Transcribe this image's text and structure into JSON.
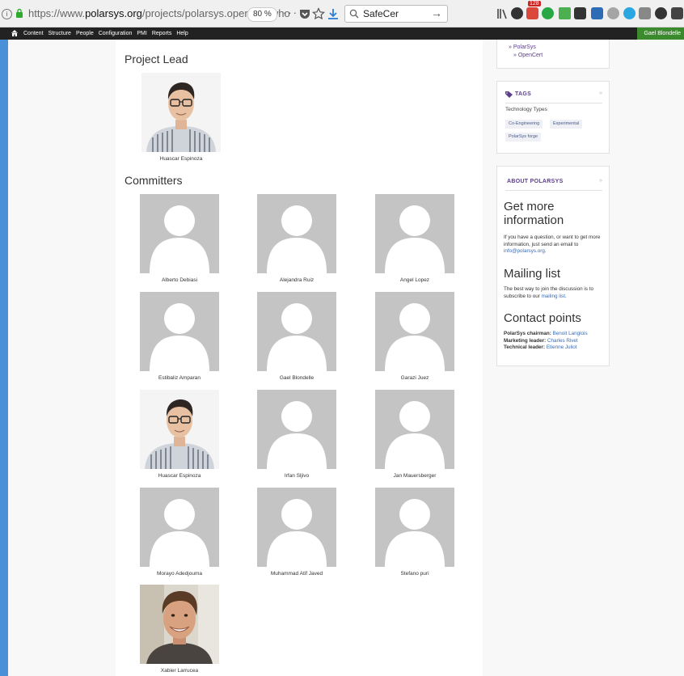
{
  "browser": {
    "url_prefix": "https://www.",
    "url_domain": "polarsys.org",
    "url_path": "/projects/polarsys.opencert/who",
    "zoom": "80 %",
    "page_actions": "···",
    "search_text": "SafeCer",
    "search_go": "→",
    "badge_128": "128",
    "info_glyph": "i"
  },
  "admin_bar": {
    "menu": [
      "Content",
      "Structure",
      "People",
      "Configuration",
      "PMI",
      "Reports",
      "Help"
    ],
    "user": "Gael Blondelle"
  },
  "project_lead": {
    "heading": "Project Lead",
    "name": "Huascar Espinoza"
  },
  "committers": {
    "heading": "Committers",
    "people": [
      {
        "name": "Alberto Debiasi",
        "photo": "placeholder"
      },
      {
        "name": "Alejandra Ruiz",
        "photo": "placeholder"
      },
      {
        "name": "Angel Lopez",
        "photo": "placeholder"
      },
      {
        "name": "Estibaliz Amparan",
        "photo": "placeholder"
      },
      {
        "name": "Gael Blondelle",
        "photo": "placeholder"
      },
      {
        "name": "Garazi Juez",
        "photo": "placeholder"
      },
      {
        "name": "Huascar Espinoza",
        "photo": "man-glasses"
      },
      {
        "name": "Irfan Sljivo",
        "photo": "placeholder"
      },
      {
        "name": "Jan Mauersberger",
        "photo": "placeholder"
      },
      {
        "name": "Morayo Adedjouma",
        "photo": "placeholder"
      },
      {
        "name": "Muhammad Atif Javed",
        "photo": "placeholder"
      },
      {
        "name": "Stefano puri",
        "photo": "placeholder"
      },
      {
        "name": "Xabier Larrucea",
        "photo": "man-smiling"
      }
    ]
  },
  "sidebar": {
    "breadcrumb": [
      "» PolarSys",
      "» OpenCert"
    ],
    "tags": {
      "title": "TAGS",
      "collapse": "»",
      "group": "Technology Types",
      "chips": [
        "Co-Engineering",
        "Experimental",
        "PolarSys forge"
      ]
    },
    "about": {
      "title": "ABOUT POLARSYS",
      "collapse": "»",
      "info_heading": "Get more information",
      "info_text": "If you have a question, or want to get more information, just send an email to",
      "info_email": "info@polarsys.org",
      "info_end": ".",
      "mailing_heading": "Mailing list",
      "mailing_text": "The best way to join the discussion is to subscribe to our",
      "mailing_link": "mailing list",
      "mailing_end": ".",
      "contact_heading": "Contact points",
      "contacts": [
        {
          "role": "PolarSys chairman:",
          "name": "Benoit Langlois"
        },
        {
          "role": "Marketing leader:",
          "name": "Charles Rivet"
        },
        {
          "role": "Technical leader:",
          "name": "Etienne Juliot"
        }
      ]
    }
  },
  "colors": {
    "accent_purple": "#5b3e8c",
    "link_blue": "#3a6bb5",
    "admin_user_green": "#3c8a2e"
  }
}
